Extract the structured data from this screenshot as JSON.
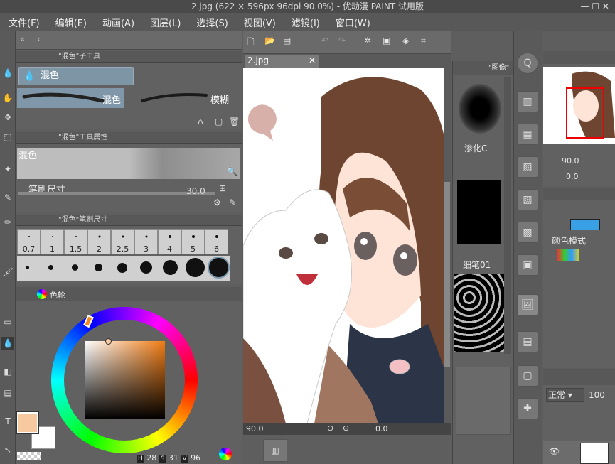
{
  "window": {
    "title": "2.jpg (622 × 596px 96dpi 90.0%) - 优动漫 PAINT 试用版",
    "controls": "— ☐ ✕"
  },
  "menu": [
    "文件(F)",
    "编辑(E)",
    "动画(A)",
    "图层(L)",
    "选择(S)",
    "视图(V)",
    "滤镜(I)",
    "窗口(W)"
  ],
  "subtool_panel": {
    "title": "\"混色\"子工具",
    "active_group": "混色",
    "items": [
      {
        "label": "混色"
      },
      {
        "label": "模糊"
      }
    ]
  },
  "tool_property": {
    "title": "\"混色\"工具属性",
    "preview_label": "混色",
    "brush_size_label": "笔刷尺寸",
    "brush_size_value": "30.0"
  },
  "brush_size_panel": {
    "title": "\"混色\"笔刷尺寸",
    "sizes": [
      "0.7",
      "1",
      "1.5",
      "2",
      "2.5",
      "3",
      "4",
      "5",
      "6"
    ]
  },
  "color_wheel": {
    "tab_label": "色轮",
    "hsv": {
      "h_label": "H",
      "h": "28",
      "s_label": "S",
      "s": "31",
      "v_label": "V",
      "v": "96"
    },
    "main_color": "#f6c9a0",
    "sub_color": "#ffffff"
  },
  "canvas": {
    "tab_label": "2.jpg",
    "zoom": "90.0",
    "rotation": "0.0"
  },
  "material_panel": {
    "title": "\"图像\"",
    "items": [
      {
        "label": "渗化C"
      },
      {
        "label": "细笔01"
      }
    ]
  },
  "navigator": {
    "zoom": "90.0",
    "rotation": "0.0"
  },
  "color_mode": {
    "label": "颜色模式"
  },
  "layer_panel": {
    "blend_mode": "正常",
    "opacity": "100"
  }
}
